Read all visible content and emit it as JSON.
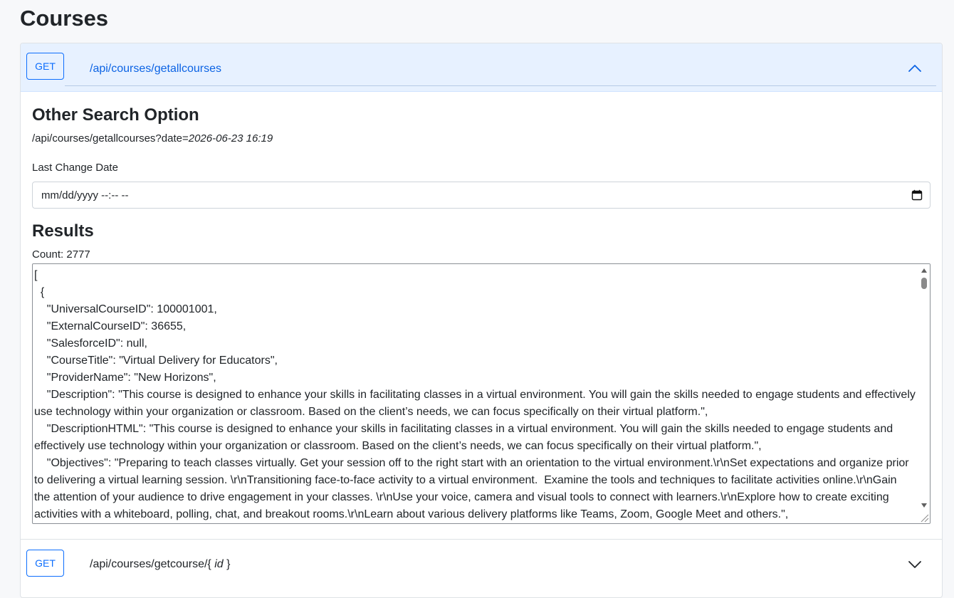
{
  "page": {
    "title": "Courses"
  },
  "endpoints": [
    {
      "method": "GET",
      "route": "/api/courses/getallcourses",
      "expanded": true,
      "chevron": "chevron-up-icon"
    },
    {
      "method": "GET",
      "route_prefix": "/api/courses/getcourse/{ ",
      "route_param": "id",
      "route_suffix": " }",
      "expanded": false,
      "chevron": "chevron-down-icon"
    }
  ],
  "search": {
    "heading": "Other Search Option",
    "example_prefix": "/api/courses/getallcourses?date=",
    "example_value": "2026-06-23 16:19",
    "label": "Last Change Date",
    "input_value": "mm/dd/yyyy --:-- --",
    "input_icon": "calendar-icon"
  },
  "results": {
    "heading": "Results",
    "count_label": "Count: 2777",
    "json_text": "[\n  {\n    \"UniversalCourseID\": 100001001,\n    \"ExternalCourseID\": 36655,\n    \"SalesforceID\": null,\n    \"CourseTitle\": \"Virtual Delivery for Educators\",\n    \"ProviderName\": \"New Horizons\",\n    \"Description\": \"This course is designed to enhance your skills in facilitating classes in a virtual environment. You will gain the skills needed to engage students and effectively use technology within your organization or classroom. Based on the client’s needs, we can focus specifically on their virtual platform.\",\n    \"DescriptionHTML\": \"This course is designed to enhance your skills in facilitating classes in a virtual environment. You will gain the skills needed to engage students and effectively use technology within your organization or classroom. Based on the client’s needs, we can focus specifically on their virtual platform.\",\n    \"Objectives\": \"Preparing to teach classes virtually. Get your session off to the right start with an orientation to the virtual environment.\\r\\nSet expectations and organize prior to delivering a virtual learning session. \\r\\nTransitioning face-to-face activity to a virtual environment.  Examine the tools and techniques to facilitate activities online.\\r\\nGain the attention of your audience to drive engagement in your classes. \\r\\nUse your voice, camera and visual tools to connect with learners.\\r\\nExplore how to create exciting activities with a whiteboard, polling, chat, and breakout rooms.\\r\\nLearn about various delivery platforms like Teams, Zoom, Google Meet and others.\","
  },
  "colors": {
    "accent": "#0d6efd",
    "header_bg": "#e7f1ff",
    "route_expanded": "#0c63e4",
    "route_collapsed": "#212529"
  }
}
